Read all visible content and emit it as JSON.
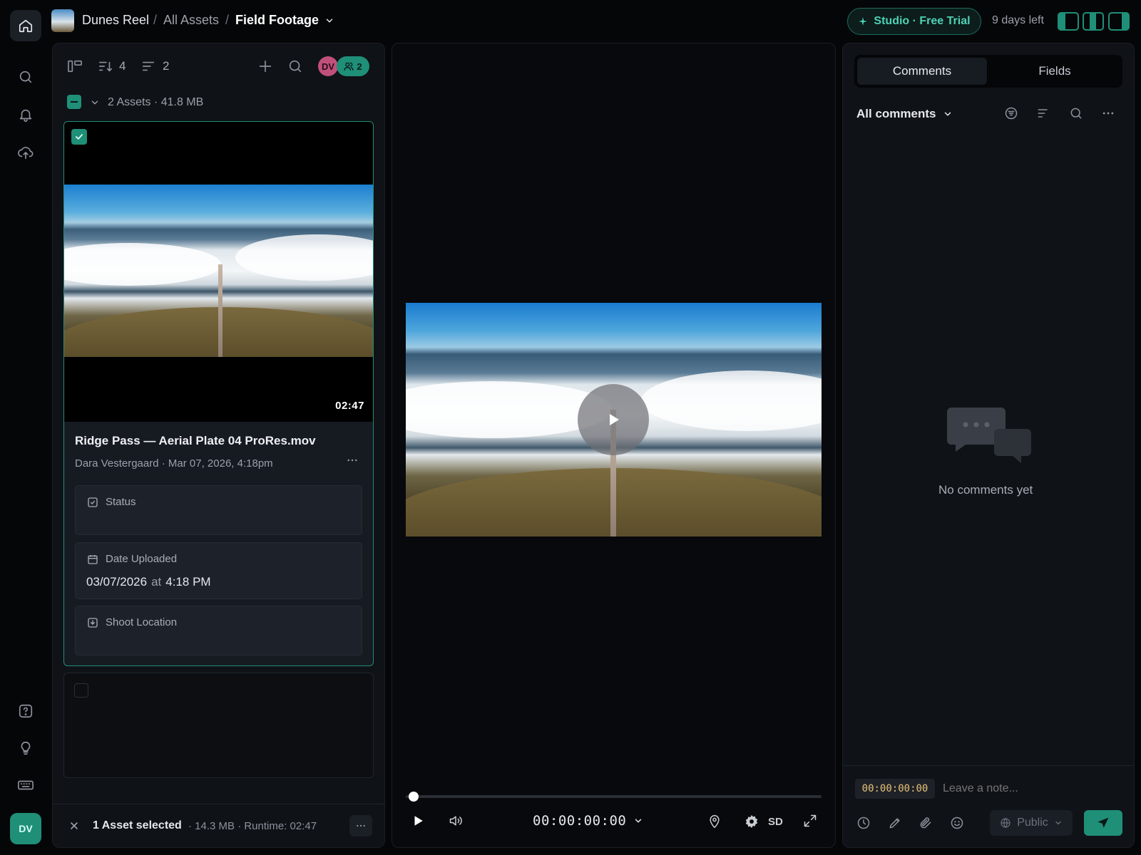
{
  "breadcrumb": {
    "project": "Dunes Reel",
    "separator": "/",
    "level1": "All Assets",
    "current": "Field Footage"
  },
  "trial": {
    "label": "Studio · Free Trial",
    "days_left": "9 days left"
  },
  "rail": {
    "icons": [
      "home-icon",
      "search-icon",
      "bell-icon",
      "upload-cloud-icon",
      "help-icon",
      "lightbulb-icon",
      "keyboard-icon"
    ],
    "avatar": "DV"
  },
  "assets_panel": {
    "sort_count": "4",
    "filter_count": "2",
    "avatar_initials": "DV",
    "collaborators_count": "2",
    "summary": "2 Assets · 41.8 MB",
    "card": {
      "duration": "02:47",
      "title": "Ridge Pass — Aerial Plate 04 ProRes.mov",
      "meta": "Dara Vestergaard · Mar 07, 2026, 4:18pm",
      "fields": [
        {
          "label": "Status",
          "value": ""
        },
        {
          "label": "Date Uploaded",
          "date": "03/07/2026",
          "at": "at",
          "time": "4:18 PM"
        },
        {
          "label": "Shoot Location",
          "value": ""
        }
      ]
    },
    "footer": {
      "selected": "1 Asset selected",
      "details": "· 14.3 MB · Runtime: 02:47"
    }
  },
  "player": {
    "timecode": "00:00:00:00",
    "quality": "SD",
    "progress": 0
  },
  "comments_panel": {
    "tabs": [
      "Comments",
      "Fields"
    ],
    "filter_label": "All comments",
    "empty_text": "No comments yet",
    "composer": {
      "timecode": "00:00:00:00",
      "placeholder": "Leave a note...",
      "visibility": "Public"
    }
  },
  "colors": {
    "accent": "#1f8f78",
    "accent_text": "#4fd1b5",
    "avatar_pink": "#c0507a",
    "timecode_amber": "#e8c178"
  }
}
